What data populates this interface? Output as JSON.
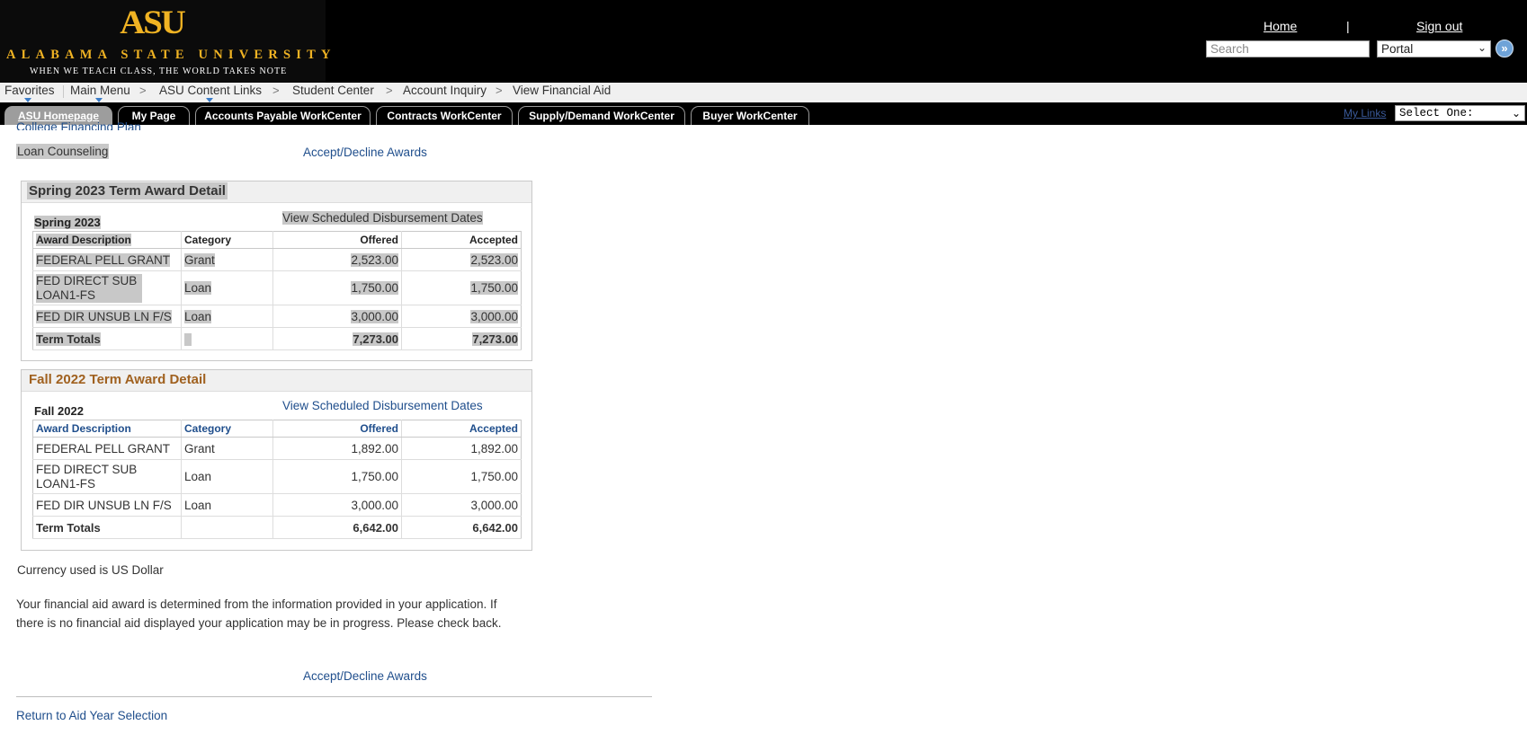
{
  "header": {
    "logo": {
      "mark": "ASU",
      "university": "ALABAMA STATE UNIVERSITY",
      "tagline": "WHEN WE TEACH CLASS, THE WORLD TAKES NOTE"
    },
    "home_link": "Home",
    "separator": "|",
    "signout_link": "Sign out",
    "search_placeholder": "Search",
    "search_scope": "Portal",
    "go_icon": "double-chevron-right-icon"
  },
  "breadcrumbs": {
    "items": [
      "Favorites",
      "Main Menu",
      "ASU Content Links",
      "Student Center",
      "Account Inquiry",
      "View Financial Aid"
    ],
    "separator": ">"
  },
  "tabs": {
    "items": [
      "ASU Homepage",
      "My Page",
      "Accounts Payable WorkCenter",
      "Contracts WorkCenter",
      "Supply/Demand WorkCenter",
      "Buyer WorkCenter"
    ],
    "active_index": 0,
    "my_links": "My Links",
    "select_one": "Select One:"
  },
  "content": {
    "college_financing_plan": "College Financing Plan",
    "loan_counseling": "Loan Counseling",
    "accept_decline": "Accept/Decline Awards",
    "currency_note": "Currency used is US Dollar",
    "paragraph": "Your financial aid award is determined from the information provided in your application. If there is no financial aid displayed your application may be in progress. Please check back.",
    "return_link": "Return to Aid Year Selection"
  },
  "columns": [
    "Award Description",
    "Category",
    "Offered",
    "Accepted"
  ],
  "view_disbursement": "View Scheduled Disbursement Dates",
  "spring": {
    "title": "Spring 2023 Term Award Detail",
    "term": "Spring 2023",
    "rows": [
      [
        "FEDERAL PELL GRANT",
        "Grant",
        "2,523.00",
        "2,523.00"
      ],
      [
        "FED DIRECT SUB LOAN1-FS",
        "Loan",
        "1,750.00",
        "1,750.00"
      ],
      [
        "FED DIR UNSUB LN F/S",
        "Loan",
        "3,000.00",
        "3,000.00"
      ]
    ],
    "totals": [
      "Term Totals",
      "",
      "7,273.00",
      "7,273.00"
    ]
  },
  "fall": {
    "title": "Fall 2022 Term Award Detail",
    "term": "Fall 2022",
    "rows": [
      [
        "FEDERAL PELL GRANT",
        "Grant",
        "1,892.00",
        "1,892.00"
      ],
      [
        "FED DIRECT SUB LOAN1-FS",
        "Loan",
        "1,750.00",
        "1,750.00"
      ],
      [
        "FED DIR UNSUB LN F/S",
        "Loan",
        "3,000.00",
        "3,000.00"
      ]
    ],
    "totals": [
      "Term Totals",
      "",
      "6,642.00",
      "6,642.00"
    ]
  },
  "colors": {
    "header_bg": "#000000",
    "logo_gold": "#f0b323",
    "link": "#1f4e8c",
    "fall_title": "#a0611f",
    "highlight": "#c8c8c8"
  }
}
